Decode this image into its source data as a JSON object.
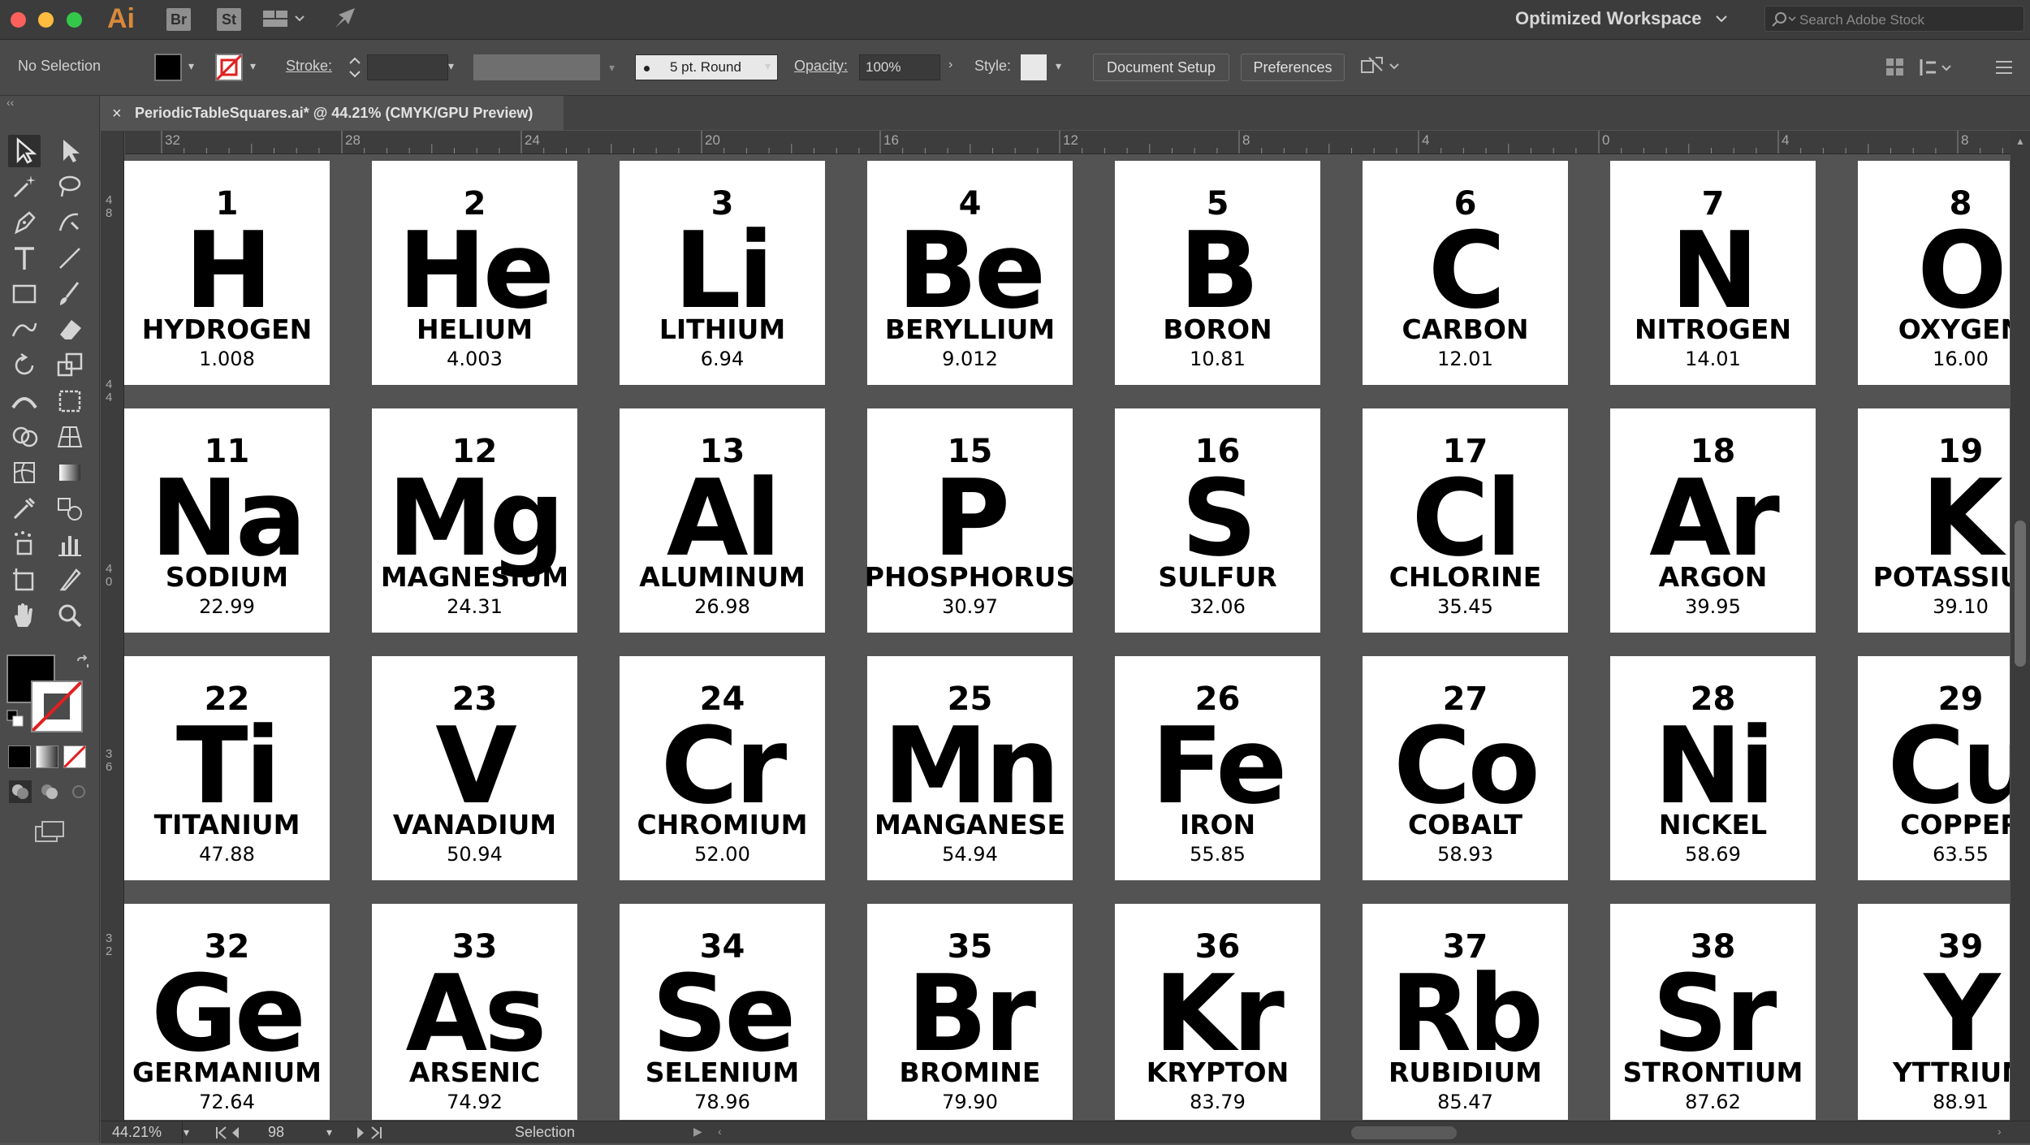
{
  "app": {
    "logo": "Ai",
    "bridge": "Br",
    "stock": "St",
    "workspace": "Optimized Workspace",
    "search_placeholder": "Search Adobe Stock"
  },
  "control_bar": {
    "selection": "No Selection",
    "stroke_label": "Stroke:",
    "brush": "5 pt. Round",
    "opacity_label": "Opacity:",
    "opacity_value": "100%",
    "style_label": "Style:",
    "document_setup": "Document Setup",
    "preferences": "Preferences"
  },
  "document": {
    "tab_title": "PeriodicTableSquares.ai* @ 44.21% (CMYK/GPU Preview)"
  },
  "ruler": {
    "h_labels": [
      "32",
      "28",
      "24",
      "20",
      "16",
      "12",
      "8",
      "4",
      "0",
      "4",
      "8"
    ],
    "v_labels": [
      "4\n8",
      "4\n4",
      "4\n0",
      "3\n6",
      "3\n2"
    ]
  },
  "elements": [
    {
      "num": "1",
      "sym": "H",
      "name": "HYDROGEN",
      "mass": "1.008"
    },
    {
      "num": "2",
      "sym": "He",
      "name": "HELIUM",
      "mass": "4.003"
    },
    {
      "num": "3",
      "sym": "Li",
      "name": "LITHIUM",
      "mass": "6.94"
    },
    {
      "num": "4",
      "sym": "Be",
      "name": "BERYLLIUM",
      "mass": "9.012"
    },
    {
      "num": "5",
      "sym": "B",
      "name": "BORON",
      "mass": "10.81"
    },
    {
      "num": "6",
      "sym": "C",
      "name": "CARBON",
      "mass": "12.01"
    },
    {
      "num": "7",
      "sym": "N",
      "name": "NITROGEN",
      "mass": "14.01"
    },
    {
      "num": "8",
      "sym": "O",
      "name": "OXYGEN",
      "mass": "16.00"
    },
    {
      "num": "11",
      "sym": "Na",
      "name": "SODIUM",
      "mass": "22.99"
    },
    {
      "num": "12",
      "sym": "Mg",
      "name": "MAGNESIUM",
      "mass": "24.31"
    },
    {
      "num": "13",
      "sym": "Al",
      "name": "ALUMINUM",
      "mass": "26.98"
    },
    {
      "num": "15",
      "sym": "P",
      "name": "PHOSPHORUS",
      "mass": "30.97"
    },
    {
      "num": "16",
      "sym": "S",
      "name": "SULFUR",
      "mass": "32.06"
    },
    {
      "num": "17",
      "sym": "Cl",
      "name": "CHLORINE",
      "mass": "35.45"
    },
    {
      "num": "18",
      "sym": "Ar",
      "name": "ARGON",
      "mass": "39.95"
    },
    {
      "num": "19",
      "sym": "K",
      "name": "POTASSIUM",
      "mass": "39.10"
    },
    {
      "num": "22",
      "sym": "Ti",
      "name": "TITANIUM",
      "mass": "47.88"
    },
    {
      "num": "23",
      "sym": "V",
      "name": "VANADIUM",
      "mass": "50.94"
    },
    {
      "num": "24",
      "sym": "Cr",
      "name": "CHROMIUM",
      "mass": "52.00"
    },
    {
      "num": "25",
      "sym": "Mn",
      "name": "MANGANESE",
      "mass": "54.94"
    },
    {
      "num": "26",
      "sym": "Fe",
      "name": "IRON",
      "mass": "55.85"
    },
    {
      "num": "27",
      "sym": "Co",
      "name": "COBALT",
      "mass": "58.93"
    },
    {
      "num": "28",
      "sym": "Ni",
      "name": "NICKEL",
      "mass": "58.69"
    },
    {
      "num": "29",
      "sym": "Cu",
      "name": "COPPER",
      "mass": "63.55"
    },
    {
      "num": "32",
      "sym": "Ge",
      "name": "GERMANIUM",
      "mass": "72.64"
    },
    {
      "num": "33",
      "sym": "As",
      "name": "ARSENIC",
      "mass": "74.92"
    },
    {
      "num": "34",
      "sym": "Se",
      "name": "SELENIUM",
      "mass": "78.96"
    },
    {
      "num": "35",
      "sym": "Br",
      "name": "BROMINE",
      "mass": "79.90"
    },
    {
      "num": "36",
      "sym": "Kr",
      "name": "KRYPTON",
      "mass": "83.79"
    },
    {
      "num": "37",
      "sym": "Rb",
      "name": "RUBIDIUM",
      "mass": "85.47"
    },
    {
      "num": "38",
      "sym": "Sr",
      "name": "STRONTIUM",
      "mass": "87.62"
    },
    {
      "num": "39",
      "sym": "Y",
      "name": "YTTRIUM",
      "mass": "88.91"
    }
  ],
  "status_bar": {
    "zoom": "44.21%",
    "artboard": "98",
    "tool": "Selection"
  }
}
